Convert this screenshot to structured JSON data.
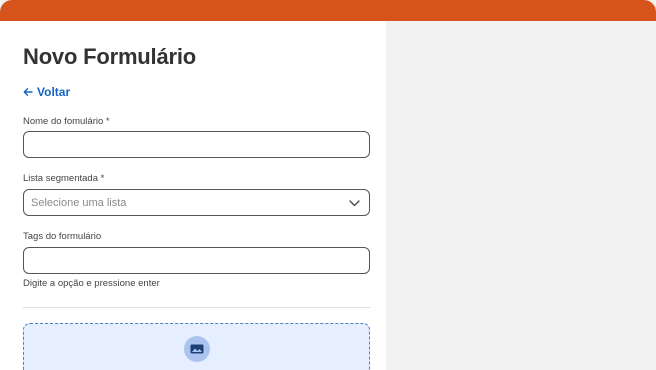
{
  "form": {
    "title": "Novo Formulário",
    "back_label": "Voltar",
    "name_field": {
      "label": "Nome do fomulário *",
      "value": "",
      "placeholder": ""
    },
    "list_field": {
      "label": "Lista segmentada *",
      "selected": "Selecione uma lista"
    },
    "tags_field": {
      "label": "Tags do formulário",
      "value": "",
      "placeholder": "",
      "helper": "Digite a opção e pressione enter"
    }
  },
  "colors": {
    "header_bar": "#d6531c",
    "link": "#1565c0",
    "dropzone_bg": "#e6efff",
    "dropzone_border": "#4a7fc9"
  },
  "icons": {
    "back": "arrow-left-icon",
    "select": "chevron-down-icon",
    "upload": "image-icon"
  }
}
